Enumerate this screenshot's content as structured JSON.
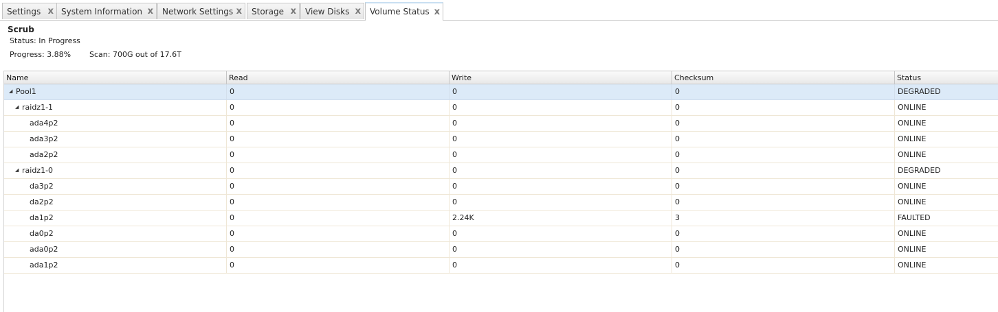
{
  "tabs": [
    {
      "label": "Settings",
      "active": false
    },
    {
      "label": "System Information",
      "active": false
    },
    {
      "label": "Network Settings",
      "active": false
    },
    {
      "label": "Storage",
      "active": false
    },
    {
      "label": "View Disks",
      "active": false
    },
    {
      "label": "Volume Status",
      "active": true
    }
  ],
  "close_glyph": "x",
  "scrub": {
    "title": "Scrub",
    "status": "Status: In Progress",
    "progress": "Progress: 3.88%",
    "scan": "Scan: 700G out of 17.6T"
  },
  "table": {
    "columns": [
      "Name",
      "Read",
      "Write",
      "Checksum",
      "Status"
    ],
    "rows": [
      {
        "name": "Pool1",
        "read": "0",
        "write": "0",
        "checksum": "0",
        "status": "DEGRADED"
      },
      {
        "name": "raidz1-1",
        "read": "0",
        "write": "0",
        "checksum": "0",
        "status": "ONLINE"
      },
      {
        "name": "ada4p2",
        "read": "0",
        "write": "0",
        "checksum": "0",
        "status": "ONLINE"
      },
      {
        "name": "ada3p2",
        "read": "0",
        "write": "0",
        "checksum": "0",
        "status": "ONLINE"
      },
      {
        "name": "ada2p2",
        "read": "0",
        "write": "0",
        "checksum": "0",
        "status": "ONLINE"
      },
      {
        "name": "raidz1-0",
        "read": "0",
        "write": "0",
        "checksum": "0",
        "status": "DEGRADED"
      },
      {
        "name": "da3p2",
        "read": "0",
        "write": "0",
        "checksum": "0",
        "status": "ONLINE"
      },
      {
        "name": "da2p2",
        "read": "0",
        "write": "0",
        "checksum": "0",
        "status": "ONLINE"
      },
      {
        "name": "da1p2",
        "read": "0",
        "write": "2.24K",
        "checksum": "3",
        "status": "FAULTED"
      },
      {
        "name": "da0p2",
        "read": "0",
        "write": "0",
        "checksum": "0",
        "status": "ONLINE"
      },
      {
        "name": "ada0p2",
        "read": "0",
        "write": "0",
        "checksum": "0",
        "status": "ONLINE"
      },
      {
        "name": "ada1p2",
        "read": "0",
        "write": "0",
        "checksum": "0",
        "status": "ONLINE"
      }
    ]
  },
  "colors": {
    "selected_row": "#dceaf8",
    "active_tab_accent": "#c8dff2"
  }
}
